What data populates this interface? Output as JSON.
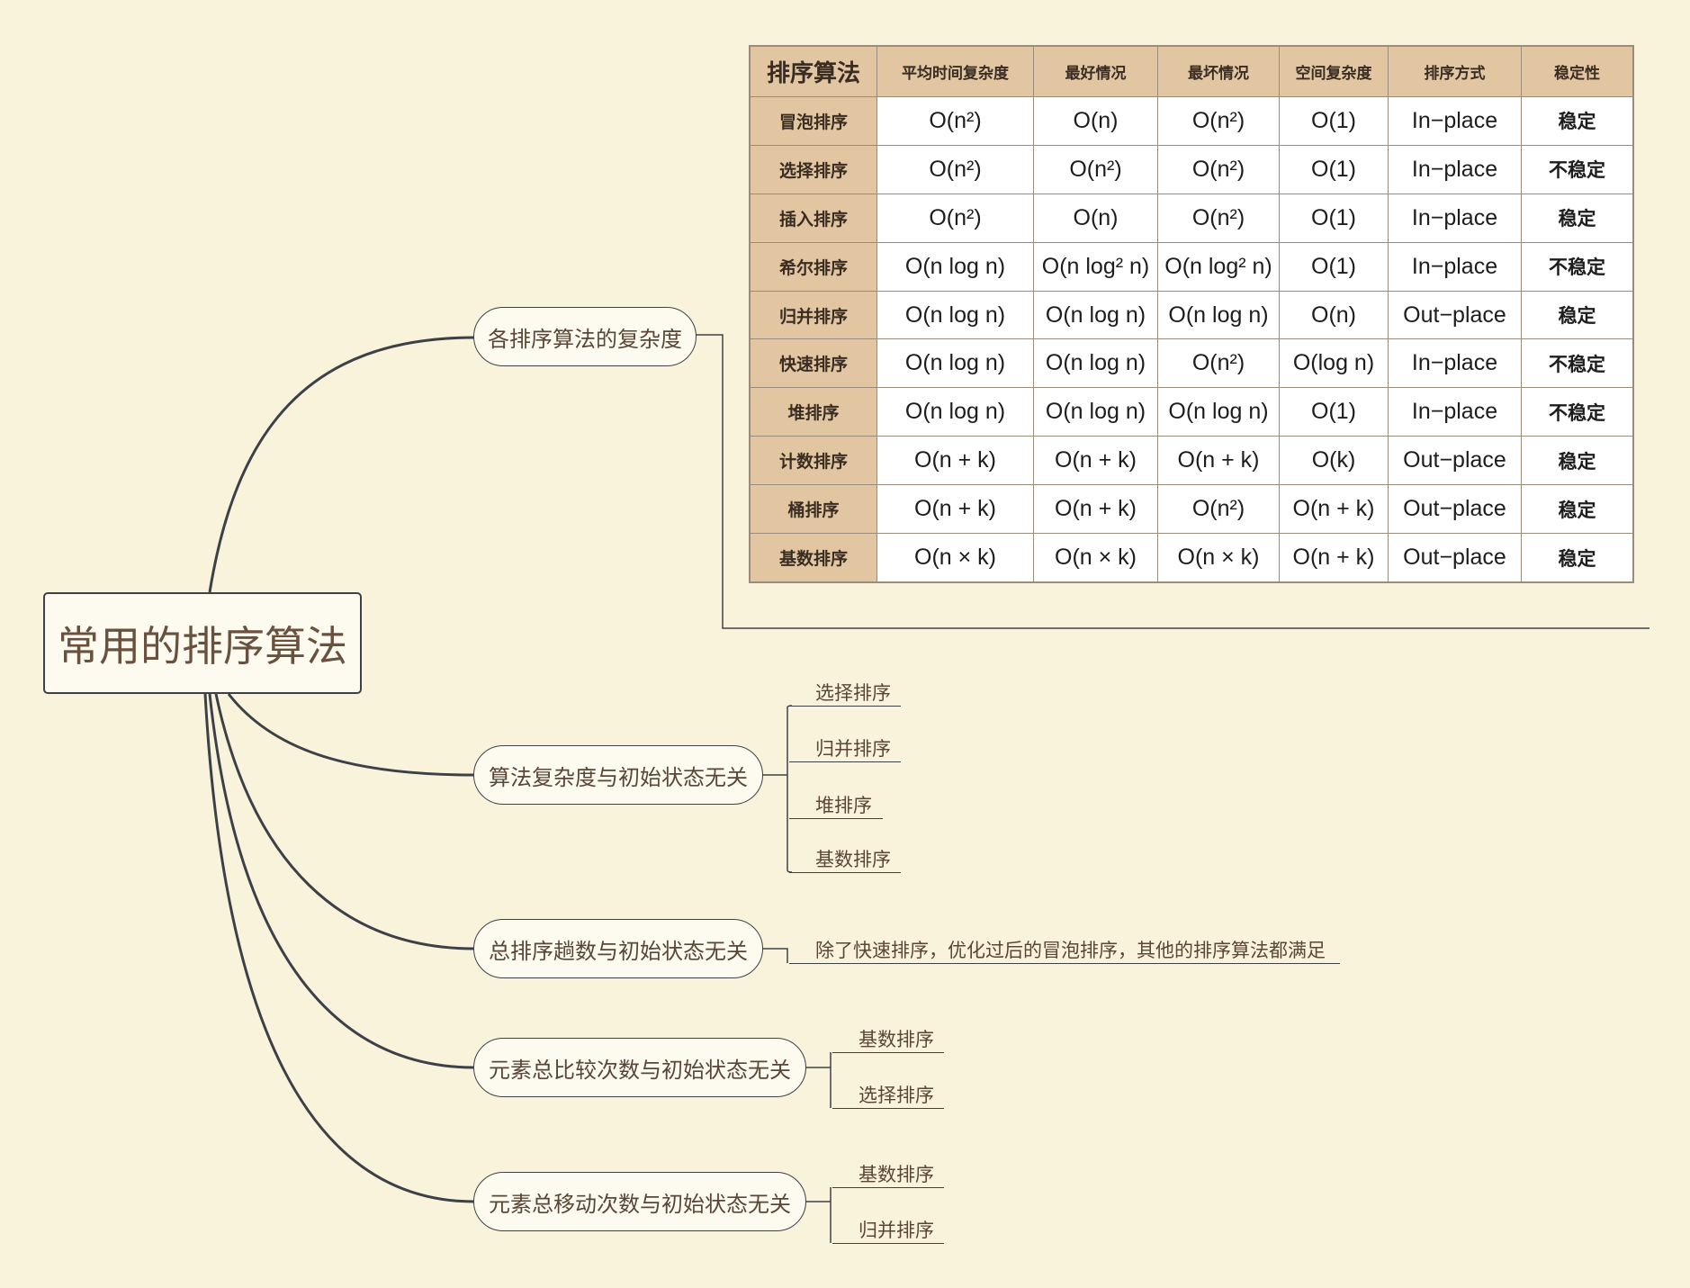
{
  "root": {
    "label": "常用的排序算法"
  },
  "branches": {
    "complexity": {
      "label": "各排序算法的复杂度"
    },
    "complexity_independent": {
      "label": "算法复杂度与初始状态无关",
      "items": [
        "选择排序",
        "归并排序",
        "堆排序",
        "基数排序"
      ]
    },
    "passes_independent": {
      "label": "总排序趟数与初始状态无关",
      "items": [
        "除了快速排序，优化过后的冒泡排序，其他的排序算法都满足"
      ]
    },
    "comparisons_independent": {
      "label": "元素总比较次数与初始状态无关",
      "items": [
        "基数排序",
        "选择排序"
      ]
    },
    "moves_independent": {
      "label": "元素总移动次数与初始状态无关",
      "items": [
        "基数排序",
        "归并排序"
      ]
    }
  },
  "table": {
    "headers": [
      "排序算法",
      "平均时间复杂度",
      "最好情况",
      "最坏情况",
      "空间复杂度",
      "排序方式",
      "稳定性"
    ],
    "rows": [
      [
        "冒泡排序",
        "O(n²)",
        "O(n)",
        "O(n²)",
        "O(1)",
        "In−place",
        "稳定"
      ],
      [
        "选择排序",
        "O(n²)",
        "O(n²)",
        "O(n²)",
        "O(1)",
        "In−place",
        "不稳定"
      ],
      [
        "插入排序",
        "O(n²)",
        "O(n)",
        "O(n²)",
        "O(1)",
        "In−place",
        "稳定"
      ],
      [
        "希尔排序",
        "O(n log n)",
        "O(n log² n)",
        "O(n log² n)",
        "O(1)",
        "In−place",
        "不稳定"
      ],
      [
        "归并排序",
        "O(n log n)",
        "O(n log n)",
        "O(n log n)",
        "O(n)",
        "Out−place",
        "稳定"
      ],
      [
        "快速排序",
        "O(n log n)",
        "O(n log n)",
        "O(n²)",
        "O(log n)",
        "In−place",
        "不稳定"
      ],
      [
        "堆排序",
        "O(n log n)",
        "O(n log n)",
        "O(n log n)",
        "O(1)",
        "In−place",
        "不稳定"
      ],
      [
        "计数排序",
        "O(n + k)",
        "O(n + k)",
        "O(n + k)",
        "O(k)",
        "Out−place",
        "稳定"
      ],
      [
        "桶排序",
        "O(n + k)",
        "O(n + k)",
        "O(n²)",
        "O(n + k)",
        "Out−place",
        "稳定"
      ],
      [
        "基数排序",
        "O(n × k)",
        "O(n × k)",
        "O(n × k)",
        "O(n + k)",
        "Out−place",
        "稳定"
      ]
    ]
  },
  "colors": {
    "background": "#faf3dc",
    "line": "#3d4147",
    "text": "#5a4636",
    "table_header": "#e1c6a1"
  }
}
